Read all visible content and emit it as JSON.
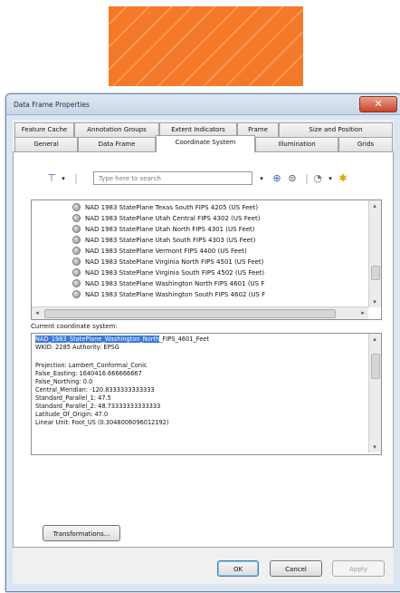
{
  "window": {
    "title": "Data Frame Properties",
    "close_glyph": "✕"
  },
  "tabs_row1": [
    "Feature Cache",
    "Annotation Groups",
    "Extent Indicators",
    "Frame",
    "Size and Position"
  ],
  "tabs_row2": [
    "General",
    "Data Frame",
    "Coordinate System",
    "Illumination",
    "Grids"
  ],
  "active_tab": "Coordinate System",
  "toolbar": {
    "filter_icon": "filter-icon",
    "search_placeholder": "Type here to search",
    "search_go_icon": "search-go-icon",
    "search_options_icon": "search-options-icon",
    "globe_menu_icon": "globe-menu-icon",
    "favorite_icon": "add-favorite-icon"
  },
  "tree_items": [
    "NAD 1983 StatePlane Texas South FIPS 4205 (US Feet)",
    "NAD 1983 StatePlane Utah Central FIPS 4302 (US Feet)",
    "NAD 1983 StatePlane Utah North FIPS 4301 (US Feet)",
    "NAD 1983 StatePlane Utah South FIPS 4303 (US Feet)",
    "NAD 1983 StatePlane Vermont FIPS 4400 (US Feet)",
    "NAD 1983 StatePlane Virginia North FIPS 4501 (US Feet)",
    "NAD 1983 StatePlane Virginia South FIPS 4502 (US Feet)",
    "NAD 1983 StatePlane Washington North FIPS 4601 (US F",
    "NAD 1983 StatePlane Washington South FIPS 4602 (US F"
  ],
  "current_cs_label": "Current coordinate system:",
  "current_cs": {
    "name_selected": "NAD_1983_StatePlane_Washington_North",
    "name_rest": "_FIPS_4601_Feet",
    "lines": [
      "WKID: 2285 Authority: EPSG",
      "",
      "Projection: Lambert_Conformal_Conic",
      "False_Easting: 1640416.666666667",
      "False_Northing: 0.0",
      "Central_Meridian: -120.8333333333333",
      "Standard_Parallel_1: 47.5",
      "Standard_Parallel_2: 48.73333333333333",
      "Latitude_Of_Origin: 47.0",
      "Linear Unit: Foot_US (0.3048006096012192)"
    ]
  },
  "buttons": {
    "transformations": "Transformations...",
    "ok": "OK",
    "cancel": "Cancel",
    "apply": "Apply"
  },
  "colors": {
    "banner": "#f47a2a",
    "selection": "#3a78d8"
  }
}
